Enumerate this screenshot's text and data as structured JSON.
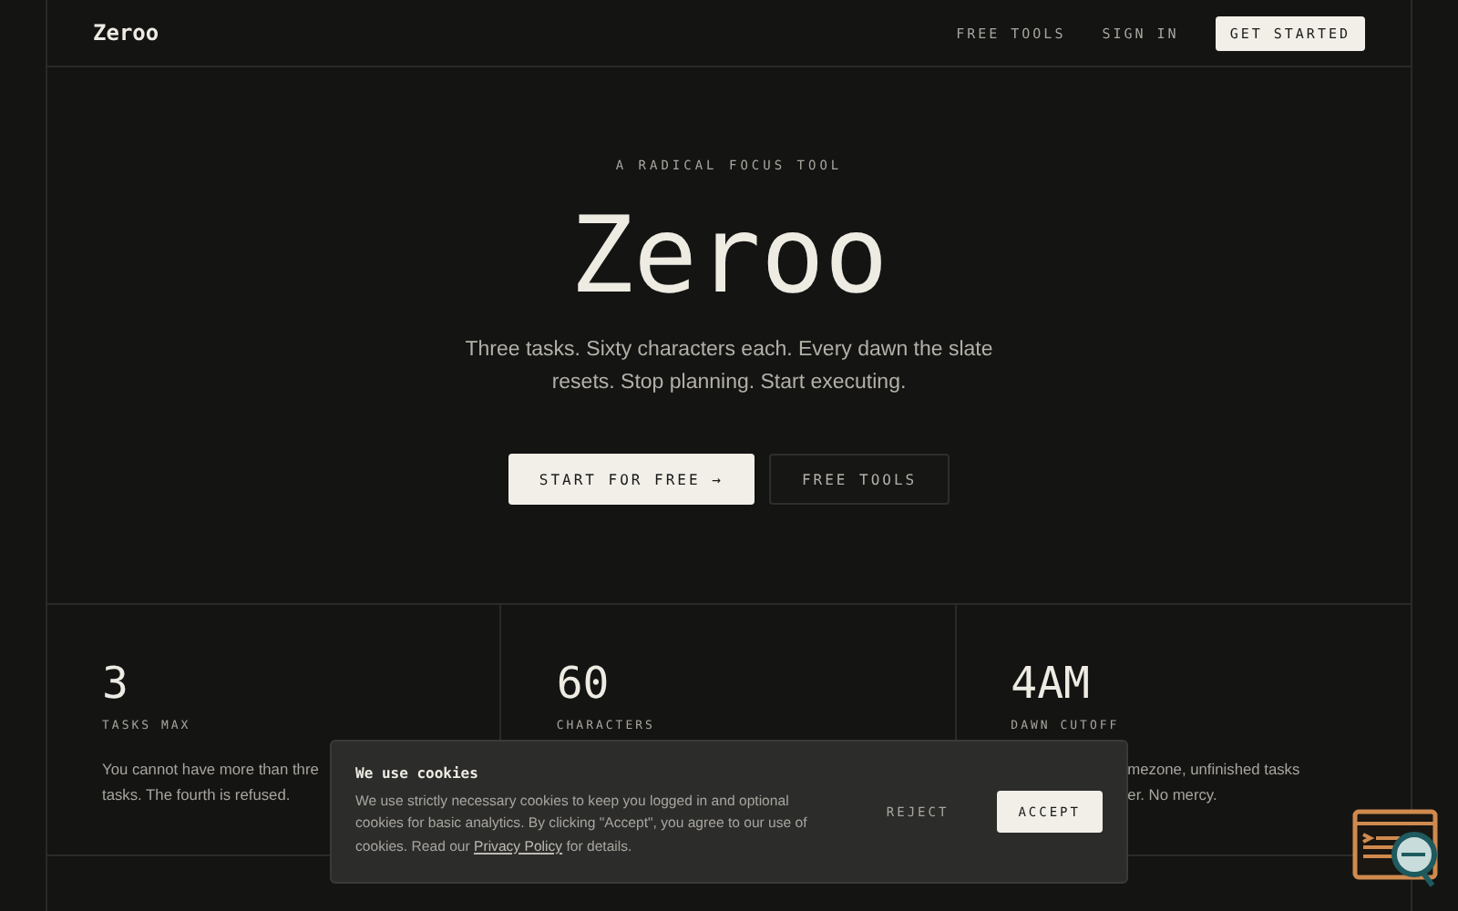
{
  "nav": {
    "logo": "Zeroo",
    "links": [
      "FREE TOOLS",
      "SIGN IN"
    ],
    "cta": "GET STARTED"
  },
  "hero": {
    "eyebrow": "A RADICAL FOCUS TOOL",
    "title": "Zeroo",
    "subtitle": "Three tasks. Sixty characters each. Every dawn the slate resets. Stop planning. Start executing.",
    "buttons": [
      {
        "label": "START FOR FREE →",
        "kind": "primary"
      },
      {
        "label": "FREE TOOLS",
        "kind": "secondary"
      }
    ]
  },
  "stats": [
    {
      "value": "3",
      "label": "TASKS MAX",
      "desc_lines": [
        "You cannot have more than thre",
        "tasks. The fourth is refused."
      ],
      "kind": "cut-right"
    },
    {
      "value": "60",
      "label": "CHARACTERS"
    },
    {
      "value": "4AM",
      "label": "DAWN CUTOFF",
      "desc_lines": [
        "mezone, unfinished tasks",
        "er. No mercy."
      ],
      "kind": "cut-left"
    }
  ],
  "cookie_banner": {
    "title": "We use cookies",
    "text_before": "We use strictly necessary cookies to keep you logged in and optional cookies for basic analytics. By clicking \"Accept\", you agree to our use of cookies. Read our",
    "link": "Privacy Policy",
    "text_after": "for details.",
    "reject": "REJECT",
    "accept": "ACCEPT"
  }
}
